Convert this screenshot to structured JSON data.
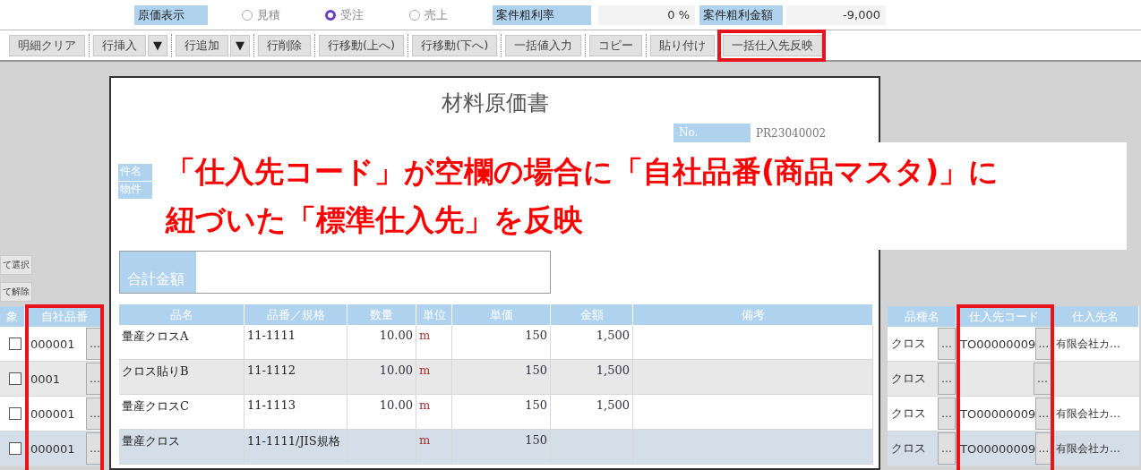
{
  "top_bar": {
    "cost_label": "原価表示",
    "options": [
      {
        "label": "見積",
        "selected": false
      },
      {
        "label": "受注",
        "selected": true
      },
      {
        "label": "売上",
        "selected": false
      }
    ],
    "fields": [
      {
        "label": "案件粗利率",
        "value": "0 %"
      },
      {
        "label": "案件粗利金額",
        "value": "-9,000"
      }
    ]
  },
  "toolbar": [
    {
      "label": "明細クリア"
    },
    {
      "label": "行挿入",
      "menu": "▼"
    },
    {
      "label": "行追加",
      "menu": "▼"
    },
    {
      "label": "行削除"
    },
    {
      "label": "行移動(上へ)"
    },
    {
      "label": "行移動(下へ)"
    },
    {
      "label": "一括値入力"
    },
    {
      "label": "コピー"
    },
    {
      "label": "貼り付け"
    },
    {
      "label": "一括仕入先反映",
      "highlighted": true
    }
  ],
  "left_panel": {
    "buttons": [
      "て選択",
      "て解除"
    ],
    "columns": [
      {
        "label": "象"
      },
      {
        "label": "自社品番",
        "highlighted": true
      }
    ],
    "rows": [
      {
        "checked": false,
        "code": "000001",
        "lookup": "…",
        "selected": false
      },
      {
        "checked": false,
        "code": "0001",
        "lookup": "…",
        "selected": false
      },
      {
        "checked": false,
        "code": "000001",
        "lookup": "…",
        "selected": false
      },
      {
        "checked": false,
        "code": "000001",
        "lookup": "…",
        "selected": true
      }
    ]
  },
  "document": {
    "title": "材料原価書",
    "no_label": "No.",
    "no_value": "PR23040002",
    "fields": [
      "件名",
      "物件"
    ],
    "total_label": "合計金額",
    "columns": [
      "品名",
      "品番／規格",
      "数量",
      "単位",
      "単価",
      "金額",
      "備考"
    ],
    "rows": [
      {
        "name": "量産クロスA",
        "spec": "11-1111",
        "qty": "10.00",
        "unit": "m",
        "price": "150",
        "amount": "1,500",
        "selected": false
      },
      {
        "name": "クロス貼りB",
        "spec": "11-1112",
        "qty": "10.00",
        "unit": "m",
        "price": "150",
        "amount": "1,500",
        "selected": false
      },
      {
        "name": "量産クロスC",
        "spec": "11-1113",
        "qty": "10.00",
        "unit": "m",
        "price": "150",
        "amount": "1,500",
        "selected": false
      },
      {
        "name": "量産クロス",
        "spec": "11-1111/JIS規格",
        "unit": "m",
        "price": "150",
        "selected": true
      }
    ]
  },
  "right_panel": {
    "columns": [
      {
        "label": "品種名"
      },
      {
        "label": "仕入先コード",
        "highlighted": true
      },
      {
        "label": "仕入先名"
      }
    ],
    "rows": [
      {
        "category": "クロス",
        "category_lookup": "…",
        "supplier_code": "TO00000009",
        "code_lookup": "…",
        "supplier_name": "有限会社カ…",
        "selected": false
      },
      {
        "category": "クロス",
        "category_lookup": "…",
        "code_lookup": "…",
        "selected": false
      },
      {
        "category": "クロス",
        "category_lookup": "…",
        "supplier_code": "TO00000009",
        "code_lookup": "…",
        "supplier_name": "有限会社カ…",
        "selected": false
      },
      {
        "category": "クロス",
        "category_lookup": "…",
        "supplier_code": "TO00000009",
        "code_lookup": "…",
        "supplier_name": "有限会社カ…",
        "selected": true
      }
    ]
  },
  "callout": {
    "lines": [
      "「仕入先コード」が空欄の場合に「自社品番(商品マスタ)」に",
      "紐づいた「標準仕入先」を反映"
    ]
  }
}
